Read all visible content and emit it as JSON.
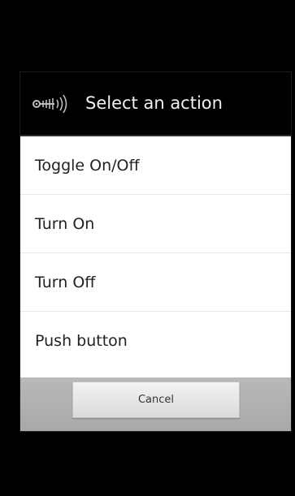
{
  "dialog": {
    "title": "Select an action",
    "icon": "remote-signal-icon",
    "options": [
      {
        "label": "Toggle On/Off"
      },
      {
        "label": "Turn On"
      },
      {
        "label": "Turn Off"
      },
      {
        "label": "Push button"
      }
    ],
    "cancel_label": "Cancel"
  },
  "colors": {
    "screen_background": "#000000",
    "header_background": "#000000",
    "header_text": "#f2f2f2",
    "option_background": "#ffffff",
    "option_text": "#222222",
    "footer_background": "#b0b0b0"
  }
}
